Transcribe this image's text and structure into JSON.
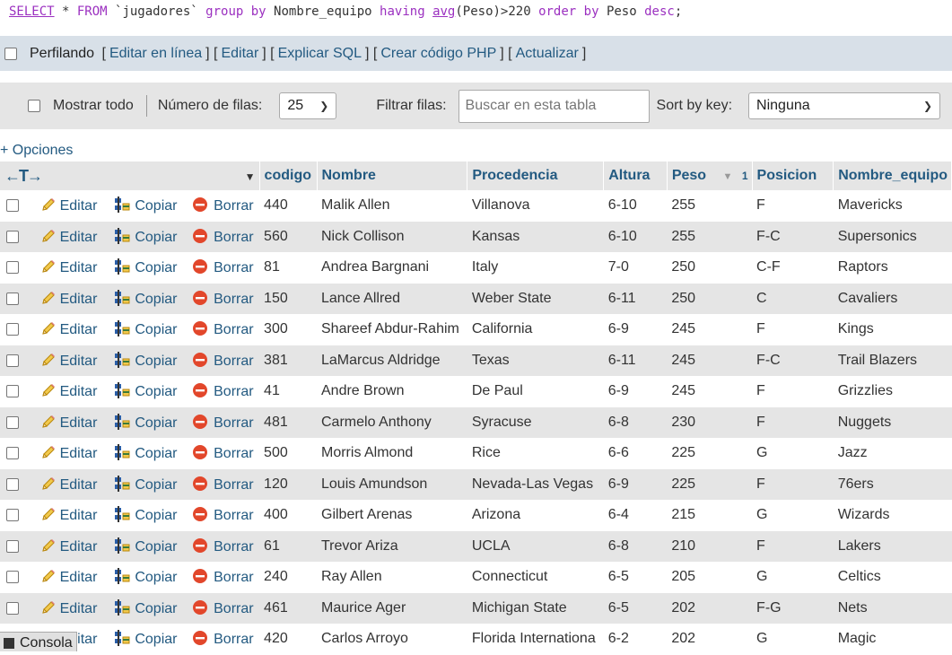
{
  "sql": {
    "parts": [
      {
        "t": "SELECT",
        "c": "kw u"
      },
      {
        "t": " * ",
        "c": "id"
      },
      {
        "t": "FROM",
        "c": "kw"
      },
      {
        "t": " `jugadores` ",
        "c": "id"
      },
      {
        "t": "group by",
        "c": "kw"
      },
      {
        "t": " Nombre_equipo ",
        "c": "id"
      },
      {
        "t": "having",
        "c": "kw"
      },
      {
        "t": " ",
        "c": "id"
      },
      {
        "t": "avg",
        "c": "fn"
      },
      {
        "t": "(Peso)>220 ",
        "c": "id"
      },
      {
        "t": "order by",
        "c": "kw"
      },
      {
        "t": " Peso ",
        "c": "id"
      },
      {
        "t": "desc",
        "c": "kw"
      },
      {
        "t": ";",
        "c": "id"
      }
    ]
  },
  "profiling": {
    "label": "Perfilando",
    "links": [
      "Editar en línea",
      "Editar",
      "Explicar SQL",
      "Crear código PHP",
      "Actualizar"
    ]
  },
  "nav": {
    "show_all": "Mostrar todo",
    "rows_label": "Número de filas:",
    "rows_value": "25",
    "filter_label": "Filtrar filas:",
    "search_placeholder": "Buscar en esta tabla",
    "sort_label": "Sort by key:",
    "sort_value": "Ninguna"
  },
  "options_label": "+ Opciones",
  "columns": [
    "codigo",
    "Nombre",
    "Procedencia",
    "Altura",
    "Peso",
    "Posicion",
    "Nombre_equipo"
  ],
  "peso_sort_index": "1",
  "actions": {
    "edit": "Editar",
    "copy": "Copiar",
    "delete": "Borrar"
  },
  "rows": [
    [
      "440",
      "Malik Allen",
      "Villanova",
      "6-10",
      "255",
      "F",
      "Mavericks"
    ],
    [
      "560",
      "Nick Collison",
      "Kansas",
      "6-10",
      "255",
      "F-C",
      "Supersonics"
    ],
    [
      "81",
      "Andrea Bargnani",
      "Italy",
      "7-0",
      "250",
      "C-F",
      "Raptors"
    ],
    [
      "150",
      "Lance Allred",
      "Weber State",
      "6-11",
      "250",
      "C",
      "Cavaliers"
    ],
    [
      "300",
      "Shareef Abdur-Rahim",
      " California",
      " 6-9",
      "245",
      "F",
      "Kings"
    ],
    [
      "381",
      "LaMarcus Aldridge",
      "Texas",
      "6-11",
      "245",
      "F-C",
      "Trail Blazers"
    ],
    [
      "41",
      "Andre Brown",
      "De Paul",
      "6-9",
      "245",
      "F",
      "Grizzlies"
    ],
    [
      "481",
      "Carmelo Anthony",
      "Syracuse",
      "6-8",
      "230",
      "F",
      "Nuggets"
    ],
    [
      "500",
      "Morris Almond",
      "Rice",
      "6-6",
      "225",
      "G",
      "Jazz"
    ],
    [
      "120",
      "Louis Amundson",
      " Nevada-Las Vegas",
      " 6-9",
      "225",
      "F",
      "76ers"
    ],
    [
      "400",
      "Gilbert Arenas",
      "Arizona",
      "6-4",
      "215",
      "G",
      "Wizards"
    ],
    [
      "61",
      "Trevor Ariza",
      "UCLA",
      "6-8",
      "210",
      "F",
      "Lakers"
    ],
    [
      "240",
      "Ray Allen",
      "Connecticut",
      "6-5",
      "205",
      "G",
      "Celtics"
    ],
    [
      "461",
      "Maurice Ager",
      "Michigan State",
      "6-5",
      "202",
      "F-G",
      "Nets"
    ],
    [
      "420",
      "Carlos Arroyo",
      "Florida Internationa",
      " 6-2",
      "202",
      "G",
      "Magic"
    ]
  ],
  "console_label": "Consola"
}
